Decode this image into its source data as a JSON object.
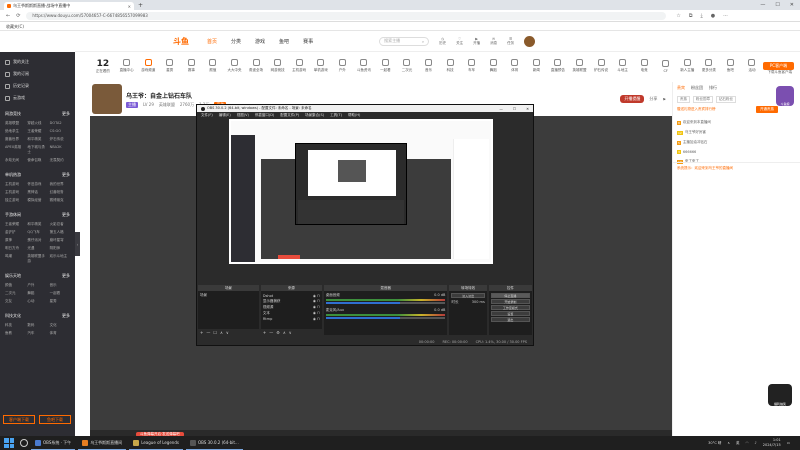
{
  "browser": {
    "tab_title": "乌王爷斯斯斯直播·战场中直播中",
    "address": "https://www.douyu.com/57004657-C-6674856557099983",
    "favorites_label": "收藏夹(C)"
  },
  "sidebar": {
    "top_items": [
      "我的关注",
      "我的订阅",
      "历史记录",
      "云游戏"
    ],
    "sections": [
      {
        "title": "网游竞技",
        "more": "更多",
        "items": [
          "英雄联盟",
          "穿越火线",
          "DOTA2",
          "绝地求生",
          "王者荣耀",
          "CS:GO",
          "魔兽世界",
          "和平精英",
          "炉石传说",
          "APEX英雄",
          "地下城与勇士",
          "NBA2K",
          "永劫无间",
          "使命召唤",
          "无畏契约"
        ]
      },
      {
        "title": "单机热游",
        "more": "更多",
        "items": [
          "主机游戏",
          "怀旧游戏",
          "我的世界",
          "主机游戏",
          "黑神话",
          "幻兽帕鲁",
          "独立游戏",
          "模拟经营",
          "赛博朋克"
        ]
      },
      {
        "title": "手游休闲",
        "more": "更多",
        "items": [
          "王者荣耀",
          "和平精英",
          "火影忍者",
          "金铲铲",
          "QQ飞车",
          "第五人格",
          "原神",
          "蛋仔派对",
          "崩坏星穹",
          "明日方舟",
          "光遇",
          "阴阳师",
          "鸣潮",
          "英雄联盟手游",
          "欢乐斗地主"
        ]
      },
      {
        "title": "娱乐天地",
        "more": "更多",
        "items": [
          "颜值",
          "户外",
          "音乐",
          "二次元",
          "舞蹈",
          "一起看",
          "交友",
          "心动",
          "星秀"
        ]
      },
      {
        "title": "科技文化",
        "more": "更多",
        "items": [
          "科技",
          "数码",
          "文化",
          "鱼教",
          "汽车",
          "体育"
        ]
      }
    ],
    "footer_buttons": [
      "客户端下载",
      "鱼吧下载"
    ]
  },
  "header": {
    "logo": "斗鱼",
    "nav": [
      "首页",
      "分类",
      "游戏",
      "鱼吧",
      "赛事"
    ],
    "active_nav": 0,
    "search_placeholder": "搜索主播",
    "icons": [
      "历史",
      "关注",
      "开播",
      "消息",
      "任务"
    ]
  },
  "category_bar": {
    "count": "12",
    "count_label": "正在看的",
    "items": [
      "直播中心",
      "游戏频道",
      "星秀",
      "赛事",
      "颜值",
      "大大中央",
      "角逐全场",
      "网游竞技",
      "主机游戏",
      "单机游戏",
      "户外",
      "斗鱼资讯",
      "一起看",
      "二次元",
      "音乐",
      "科技",
      "车车",
      "舞蹈",
      "体育",
      "新闻",
      "直播预告",
      "英雄联盟",
      "炉石传说",
      "斗地主",
      "电竞",
      "CF",
      "新人主播",
      "更多分类",
      "鱼吧",
      "活动"
    ],
    "pc_button": "PC客户端",
    "pc_sub": "下载斗鱼客户端"
  },
  "streamer": {
    "title": "乌王爷：自金上钻石车队",
    "tag1": "主播",
    "tag2": "高能",
    "meta": [
      "LV 29",
      "英雄联盟",
      "2760万",
      "1.2万",
      "分享"
    ],
    "gift_button": "开播提醒"
  },
  "obs": {
    "title": "OBS 30.0.2 (64-bit, windows) - 配置文件: 未命名 - 场景: 未命名",
    "menu": [
      "文件(F)",
      "编辑(E)",
      "视图(V)",
      "停靠窗口(D)",
      "配置文件(P)",
      "场景集合(S)",
      "工具(T)",
      "帮助(H)"
    ],
    "docks": {
      "scenes": {
        "title": "场景",
        "items": [
          "场景"
        ]
      },
      "sources": {
        "title": "来源",
        "items": [
          "Dshot",
          "显示器捕获",
          "视频源",
          "文本",
          "Rtmp"
        ]
      },
      "mixer": {
        "title": "混音器",
        "channels": [
          {
            "name": "桌面音频",
            "db": "0.0 dB"
          },
          {
            "name": "麦克风/Aux",
            "db": "0.0 dB"
          }
        ]
      },
      "transitions": {
        "title": "转场特效",
        "type": "淡入淡出",
        "duration_label": "时长",
        "duration": "300 ms"
      },
      "controls": {
        "title": "控件",
        "buttons": [
          "停止直播",
          "开始录制",
          "工作室模式",
          "设置",
          "退出"
        ]
      }
    },
    "status": [
      "00:00:00",
      "REC: 00:00:00",
      "CPU: 1.4%, 30.00 / 30.00 FPS"
    ]
  },
  "right_panel": {
    "tabs": [
      "贵宾",
      "粉丝团",
      "排行"
    ],
    "active_tab": 0,
    "badges": [
      "贵族",
      "粉丝勋章",
      "钻石粉丝"
    ],
    "notice": "赠送礼物进入贵宾排行榜",
    "open_button": "开通贵族",
    "chat": [
      {
        "level": "8",
        "text": "欢迎来到本直播间"
      },
      {
        "level": "12",
        "text": "乌王爷好厉害"
      },
      {
        "level": "5",
        "text": "主播加油冲钻石"
      },
      {
        "level": "3",
        "text": "666666"
      },
      {
        "level": "10",
        "text": "来了来了"
      }
    ],
    "system": "系统提示：欢迎来到乌王爷的直播间"
  },
  "player": {
    "danmu_button": "斗鱼弹幕开启·发送弹幕吧"
  },
  "taskbar": {
    "items": [
      {
        "label": "OBS系统 · 下午",
        "color": "#4a7bd0"
      },
      {
        "label": "乌王爷斯斯直播间",
        "color": "#e67e22"
      },
      {
        "label": "League of Legends",
        "color": "#c8a84a"
      },
      {
        "label": "OBS 30.0.2 (64-bit...",
        "color": "#555555"
      }
    ],
    "weather": "30°C 晴",
    "ime": "英",
    "time": "1:01",
    "date": "2024/7/15"
  },
  "mascot_label": "斗鱼娘",
  "mascot2_label": "福利抽奖"
}
